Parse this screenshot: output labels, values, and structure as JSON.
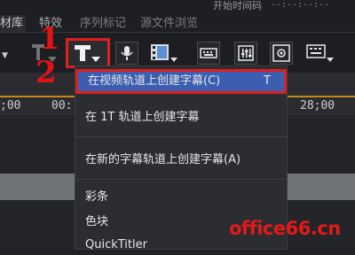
{
  "header": {
    "timecode_label": "开始时间码",
    "timecode_value": "--:--:--:--"
  },
  "tabs": [
    {
      "label": "素材库"
    },
    {
      "label": "特效"
    },
    {
      "label": "序列标记"
    },
    {
      "label": "源文件浏览"
    }
  ],
  "annotations": {
    "step1": "1",
    "step2": "2"
  },
  "timeline": {
    "ticks": [
      ";00",
      "00:",
      "28;00"
    ]
  },
  "title_menu": {
    "items": [
      {
        "label": "在视频轨道上创建字幕(C)",
        "shortcut": "T"
      },
      {
        "label": "在 1T 轨道上创建字幕",
        "shortcut": ""
      },
      {
        "label": "在新的字幕轨道上创建字幕(A)",
        "shortcut": ""
      },
      {
        "label": "彩条",
        "shortcut": ""
      },
      {
        "label": "色块",
        "shortcut": ""
      },
      {
        "label": "QuickTitler",
        "shortcut": ""
      }
    ]
  },
  "icons": {
    "title_tool": "T-icon",
    "voiceover": "microphone-icon",
    "clip_tool": "film-icon",
    "menu_tool": "keyboard-icon",
    "mixer": "mixer-icon",
    "effect": "gear-film-icon"
  },
  "colors": {
    "highlight_red": "#e01e1e",
    "selection_blue": "#3b5eb0",
    "timeline_orange": "#c7881d"
  },
  "watermark": "office66.cn"
}
